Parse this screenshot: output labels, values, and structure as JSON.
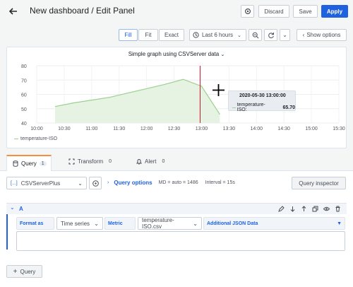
{
  "header": {
    "title": "New dashboard / Edit Panel",
    "discard": "Discard",
    "save": "Save",
    "apply": "Apply"
  },
  "toolbar": {
    "fill": "Fill",
    "fit": "Fit",
    "exact": "Exact",
    "time_range": "Last 6 hours",
    "show_options": "Show options"
  },
  "panel": {
    "title": "Simple graph using CSVServer data",
    "legend": "temperature-ISO",
    "tooltip": {
      "time": "2020-05-30 13:00:00",
      "series": "temperature-ISO:",
      "value": "65.70"
    }
  },
  "chart_data": {
    "type": "area",
    "x": [
      "10:20",
      "10:40",
      "11:00",
      "11:20",
      "11:40",
      "12:00",
      "12:20",
      "12:40",
      "13:00",
      "13:20"
    ],
    "series": [
      {
        "name": "temperature-ISO",
        "values": [
          51.5,
          54,
          56,
          58,
          61,
          64,
          67,
          70.5,
          65.7,
          46
        ]
      }
    ],
    "y_ticks": [
      "40",
      "50",
      "60",
      "70",
      "80"
    ],
    "x_ticks": [
      "10:00",
      "10:30",
      "11:00",
      "11:30",
      "12:00",
      "12:30",
      "13:00",
      "13:30",
      "14:00",
      "14:30",
      "15:00",
      "15:30"
    ],
    "ylim": [
      40,
      80
    ],
    "grid": true,
    "legend": "bottom-left",
    "colors": {
      "line": "#9bd08e",
      "fill": "#e6f3e2",
      "cursor": "#c4162a"
    }
  },
  "tabs": [
    {
      "label": "Query",
      "count": "1"
    },
    {
      "label": "Transform",
      "count": "0"
    },
    {
      "label": "Alert",
      "count": "0"
    }
  ],
  "query": {
    "datasource": "CSVServerPlus",
    "options_label": "Query options",
    "md": "MD = auto = 1486",
    "interval": "Interval = 15s",
    "inspector": "Query inspector",
    "ref": "A",
    "format_label": "Format as",
    "format_value": "Time series",
    "metric_label": "Metric",
    "metric_value": "temperature-ISO.csv",
    "json_label": "Additional JSON Data",
    "add_query": "Query"
  },
  "colors": {
    "primary": "#1f62e0",
    "link": "#1f62e0",
    "border": "#c7d0d9"
  }
}
